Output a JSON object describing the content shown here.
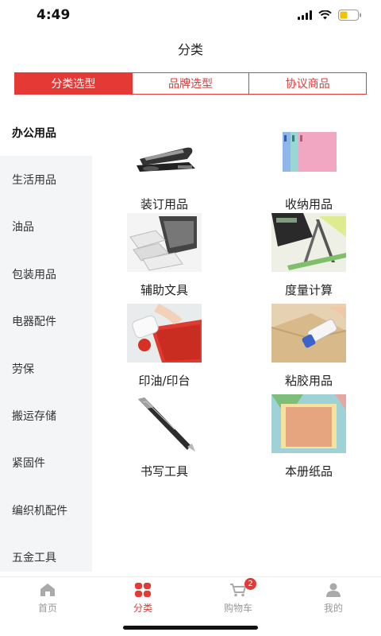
{
  "status_bar": {
    "time": "4:49"
  },
  "header": {
    "title": "分类"
  },
  "segment_tabs": [
    {
      "label": "分类选型",
      "active": true
    },
    {
      "label": "品牌选型",
      "active": false
    },
    {
      "label": "协议商品",
      "active": false
    }
  ],
  "sidebar": {
    "items": [
      {
        "label": "办公用品",
        "active": true
      },
      {
        "label": "生活用品",
        "active": false
      },
      {
        "label": "油品",
        "active": false
      },
      {
        "label": "包装用品",
        "active": false
      },
      {
        "label": "电器配件",
        "active": false
      },
      {
        "label": "劳保",
        "active": false
      },
      {
        "label": "搬运存储",
        "active": false
      },
      {
        "label": "紧固件",
        "active": false
      },
      {
        "label": "编织机配件",
        "active": false
      },
      {
        "label": "五金工具",
        "active": false
      }
    ]
  },
  "categories": [
    {
      "label": "装订用品",
      "icon": "stapler-image"
    },
    {
      "label": "收纳用品",
      "icon": "folders-image"
    },
    {
      "label": "辅助文具",
      "icon": "stamp-machine-image"
    },
    {
      "label": "度量计算",
      "icon": "calculator-compass-image"
    },
    {
      "label": "印油/印台",
      "icon": "ink-pad-image"
    },
    {
      "label": "粘胶用品",
      "icon": "glue-stick-image"
    },
    {
      "label": "书写工具",
      "icon": "pen-image"
    },
    {
      "label": "本册纸品",
      "icon": "notebook-image"
    }
  ],
  "bottom_nav": {
    "items": [
      {
        "label": "首页",
        "icon": "home-icon",
        "active": false
      },
      {
        "label": "分类",
        "icon": "grid-icon",
        "active": true
      },
      {
        "label": "购物车",
        "icon": "cart-icon",
        "active": false,
        "badge": "2"
      },
      {
        "label": "我的",
        "icon": "user-icon",
        "active": false
      }
    ]
  },
  "colors": {
    "accent": "#e53935",
    "sidebar_bg": "#f4f5f7",
    "inactive_text": "#999999"
  }
}
